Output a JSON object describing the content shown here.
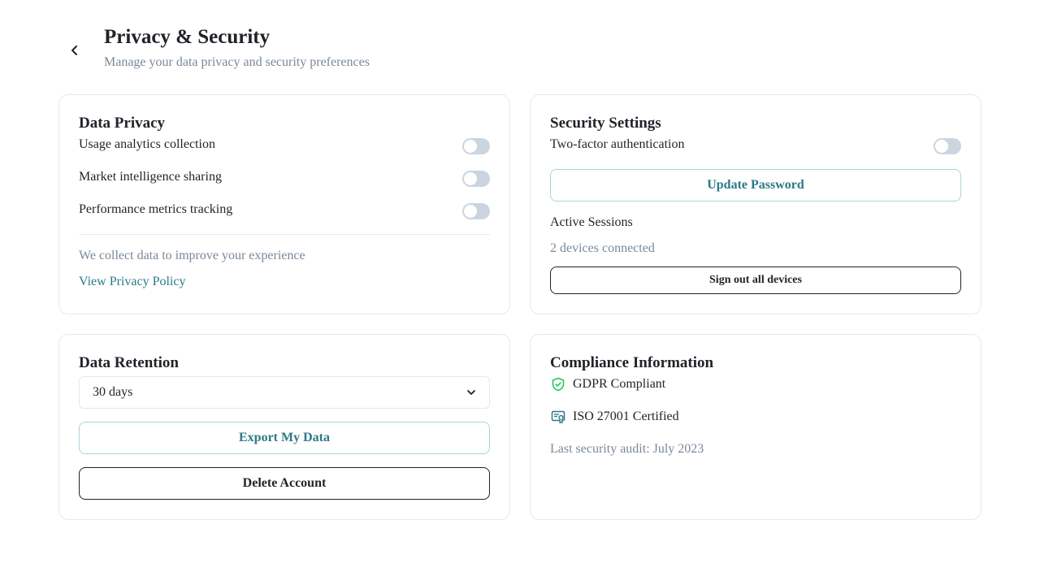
{
  "header": {
    "title": "Privacy & Security",
    "subtitle": "Manage your data privacy and security preferences"
  },
  "privacy": {
    "title": "Data Privacy",
    "toggles": [
      {
        "label": "Usage analytics collection",
        "enabled": false
      },
      {
        "label": "Market intelligence sharing",
        "enabled": false
      },
      {
        "label": "Performance metrics tracking",
        "enabled": false
      }
    ],
    "note": "We collect data to improve your experience",
    "policy_link": "View Privacy Policy"
  },
  "security": {
    "title": "Security Settings",
    "two_factor_label": "Two-factor authentication",
    "two_factor_enabled": false,
    "update_password_label": "Update Password",
    "sessions_title": "Active Sessions",
    "sessions_count": "2 devices connected",
    "sign_out_label": "Sign out all devices"
  },
  "retention": {
    "title": "Data Retention",
    "selected": "30 days",
    "export_label": "Export My Data",
    "delete_label": "Delete Account"
  },
  "compliance": {
    "title": "Compliance Information",
    "items": [
      {
        "label": "GDPR Compliant",
        "icon": "shield-check-icon"
      },
      {
        "label": "ISO 27001 Certified",
        "icon": "certificate-icon"
      }
    ],
    "audit": "Last security audit: July 2023"
  },
  "colors": {
    "accent": "#2b7a85",
    "gdpr_icon": "#22c55e",
    "toggle_off": "#cbd5e0",
    "muted_text": "#7a8899"
  }
}
